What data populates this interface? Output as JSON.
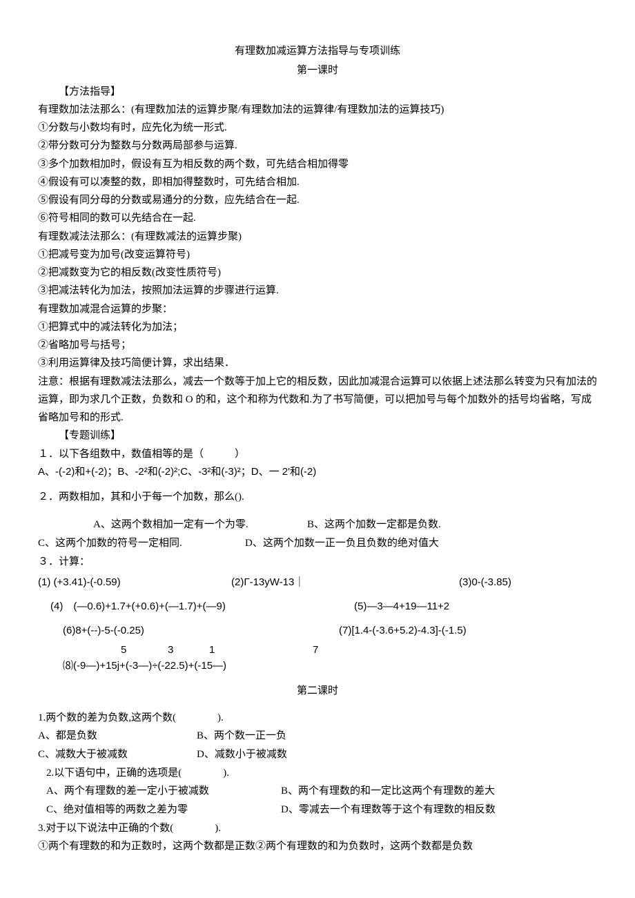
{
  "title": "有理数加减运算方法指导与专项训练",
  "lesson1": "第一课时",
  "lesson2": "第二课时",
  "section_method": "【方法指导】",
  "section_train": "【专题训练】",
  "m1": "有理数加法法那么：(有理数加法的运算步聚/有理数加法的运算律/有理数加法的运算技巧)",
  "m2": "①分数与小数均有时，应先化为统一形式.",
  "m3": "②带分数可分为整数与分数两局部参与运算.",
  "m4": "③多个加数相加时，假设有互为相反数的两个数，可先结合相加得零",
  "m5": "④假设有可以凑整的数，即相加得整数时，可先结合相加.",
  "m6": "⑤假设有同分母的分数或易通分的分数，应先结合在一起.",
  "m7": "⑥符号相同的数可以先结合在一起.",
  "m8": "有理数减法法那么：(有理数减法的运算步聚)",
  "m9": "①把减号变为加号(改变运算符号)",
  "m10": "②把减数变为它的相反数(改变性质符号)",
  "m11": "③把减法转化为加法，按照加法运算的步骤进行运算.",
  "m12": "有理数加减混合运算的步聚：",
  "m13": "①把算式中的减法转化为加法；",
  "m14": "②省略加号与括号；",
  "m15": "③利用运算律及技巧简便计算，求出结果．",
  "m16": "注意：根据有理数减法法那么，减去一个数等于加上它的相反数，因此加减混合运算可以依据上述法那么转变为只有加法的运算，即为求几个正数，负数和 O 的和，这个和称为代数和.为了书写简便，可以把加号与每个加数外的括号均省略，写成省略加号和的形式.",
  "q1": "１．以下各组数中，数值相等的是（　　　）",
  "q1opts": "A、-(-2)和+(-2)；B、-2²和(-2)²;C、-3²和(-3)²；D、一 2'和(-2)",
  "q2": "２．两数相加，其和小于每一个加数，那么().",
  "q2a": "A、这两个数相加一定有一个为零.",
  "q2b": "B、这两个加数一定都是负数.",
  "q2c": "C、这两个加数的符号一定相同.",
  "q2d": "D、这两个加数一正一负且负数的绝对值大",
  "q3": "３．计算：",
  "q3_1": "(1)  (+3.41)-(-0.59)",
  "q3_2": "(2)Γ-13yW-13｜",
  "q3_3": "(3)0-(-3.85)",
  "q3_4": "(4)　(—0.6)+1.7+(+0.6)+(—1.7)+(—9)",
  "q3_5": "(5)—3—4+19—11+2",
  "q3_6": "(6)8+(--)-5-(-0.25)",
  "q3_7": "(7)[1.4-(-3.6+5.2)-4.3]-(-1.5)",
  "q3_8_nums_a": "5",
  "q3_8_nums_b": "3",
  "q3_8_nums_c": "1",
  "q3_8_nums_d": "7",
  "q3_8": "⑻(-9—)+15j+(-3—)÷(-22.5)+(-15—)",
  "s2q1": "1.两个数的差为负数,这两个数(　　　　).",
  "s2q1a": "A、都是负数",
  "s2q1b": "B、两个数一正一负",
  "s2q1c": "C、减数大于被减数",
  "s2q1d": "D、减数小于被减数",
  "s2q2": "2.以下语句中，正确的选项是(　　　　).",
  "s2q2a": "A、两个有理数的差一定小于被减数",
  "s2q2b": "B、两个有理数的和一定比这两个有理数的差大",
  "s2q2c": "C、绝对值相等的两数之差为零",
  "s2q2d": "D、零减去一个有理数等于这个有理数的相反数",
  "s2q3": "3.对于以下说法中正确的个数(　　　　).",
  "s2q3_1": "①两个有理数的和为正数时，这两个数都是正数②两个有理数的和为负数时，这两个数都是负数"
}
